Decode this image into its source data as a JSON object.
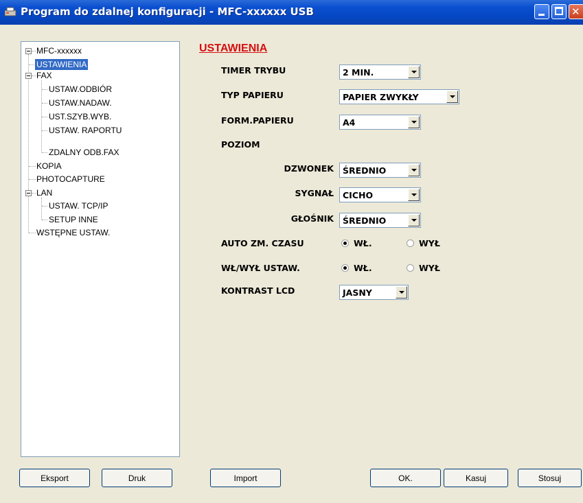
{
  "window": {
    "title": "Program do zdalnej konfiguracji - MFC-xxxxxx USB"
  },
  "tree": {
    "root": "MFC-xxxxxx",
    "items": {
      "ustawienia": "USTAWIENIA",
      "fax": "FAX",
      "ustaw_odbior": "USTAW.ODBIÓR",
      "ustaw_nadaw": "USTAW.NADAW.",
      "ust_szyb_wyb": "UST.SZYB.WYB.",
      "ustaw_raportu": "USTAW. RAPORTU",
      "zdalny_odb_fax": "ZDALNY ODB.FAX",
      "kopia": "KOPIA",
      "photocapture": "PHOTOCAPTURE",
      "lan": "LAN",
      "ustaw_tcpip": "USTAW. TCP/IP",
      "setup_inne": "SETUP INNE",
      "wstepne_ustaw": "WSTĘPNE USTAW."
    },
    "selected": "USTAWIENIA"
  },
  "panel": {
    "heading": "USTAWIENIA",
    "timer_trybu": {
      "label": "TIMER TRYBU",
      "value": "2 MIN."
    },
    "typ_papieru": {
      "label": "TYP PAPIERU",
      "value": "PAPIER ZWYKŁY"
    },
    "form_papieru": {
      "label": "FORM.PAPIERU",
      "value": "A4"
    },
    "poziom": {
      "label": "POZIOM"
    },
    "dzwonek": {
      "label": "DZWONEK",
      "value": "ŚREDNIO"
    },
    "sygnal": {
      "label": "SYGNAŁ",
      "value": "CICHO"
    },
    "glosnik": {
      "label": "GŁOŚNIK",
      "value": "ŚREDNIO"
    },
    "auto_zm_czasu": {
      "label": "AUTO ZM. CZASU",
      "on": "WŁ.",
      "off": "WYŁ",
      "selected": "WŁ."
    },
    "wl_wyl_ustaw": {
      "label": "WŁ/WYŁ USTAW.",
      "on": "WŁ.",
      "off": "WYŁ",
      "selected": "WŁ."
    },
    "kontrast_lcd": {
      "label": "KONTRAST LCD",
      "value": "JASNY"
    }
  },
  "buttons": {
    "eksport": "Eksport",
    "druk": "Druk",
    "import": "Import",
    "ok": "OK.",
    "kasuj": "Kasuj",
    "stosuj": "Stosuj"
  },
  "colors": {
    "titlebar": "#0a4fd0",
    "section_heading": "#d41010",
    "selection": "#316ac5",
    "dialog_bg": "#ece9d8"
  },
  "icons": [
    "app-icon",
    "minimize-icon",
    "maximize-icon",
    "close-icon",
    "dropdown-arrow-icon",
    "tree-collapse-icon"
  ]
}
